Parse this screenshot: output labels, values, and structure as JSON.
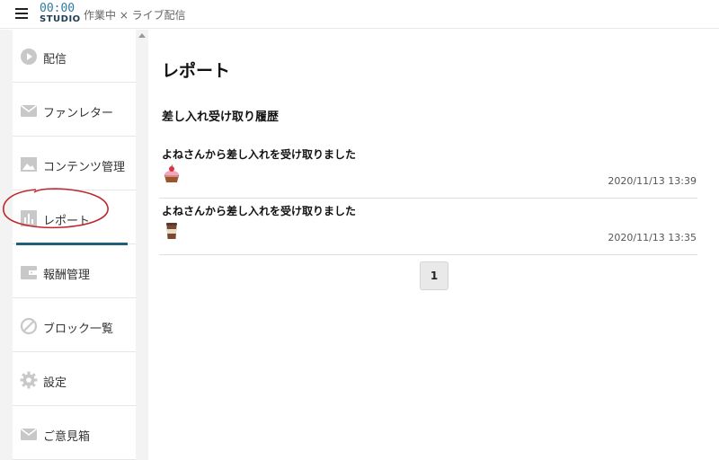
{
  "header": {
    "logo_top": "00:00",
    "logo_bottom": "STUDIO",
    "breadcrumb": "作業中 × ライブ配信"
  },
  "sidebar": {
    "items": [
      {
        "label": "配信",
        "icon": "play-icon"
      },
      {
        "label": "ファンレター",
        "icon": "mail-icon"
      },
      {
        "label": "コンテンツ管理",
        "icon": "image-icon"
      },
      {
        "label": "レポート",
        "icon": "bar-chart-icon",
        "active": true
      },
      {
        "label": "報酬管理",
        "icon": "wallet-icon"
      },
      {
        "label": "ブロック一覧",
        "icon": "block-icon"
      },
      {
        "label": "設定",
        "icon": "gear-icon"
      },
      {
        "label": "ご意見箱",
        "icon": "mail-icon"
      }
    ]
  },
  "main": {
    "title": "レポート",
    "section_title": "差し入れ受け取り履歴",
    "entries": [
      {
        "text": "よねさんから差し入れを受け取りました",
        "icon": "cake-icon",
        "time": "2020/11/13 13:39"
      },
      {
        "text": "よねさんから差し入れを受け取りました",
        "icon": "coffee-icon",
        "time": "2020/11/13 13:35"
      }
    ],
    "pager": {
      "current": "1"
    }
  },
  "colors": {
    "brand": "#2c7aa0",
    "active_underline": "#1f5f7a",
    "annotation_red": "#c0262d"
  }
}
